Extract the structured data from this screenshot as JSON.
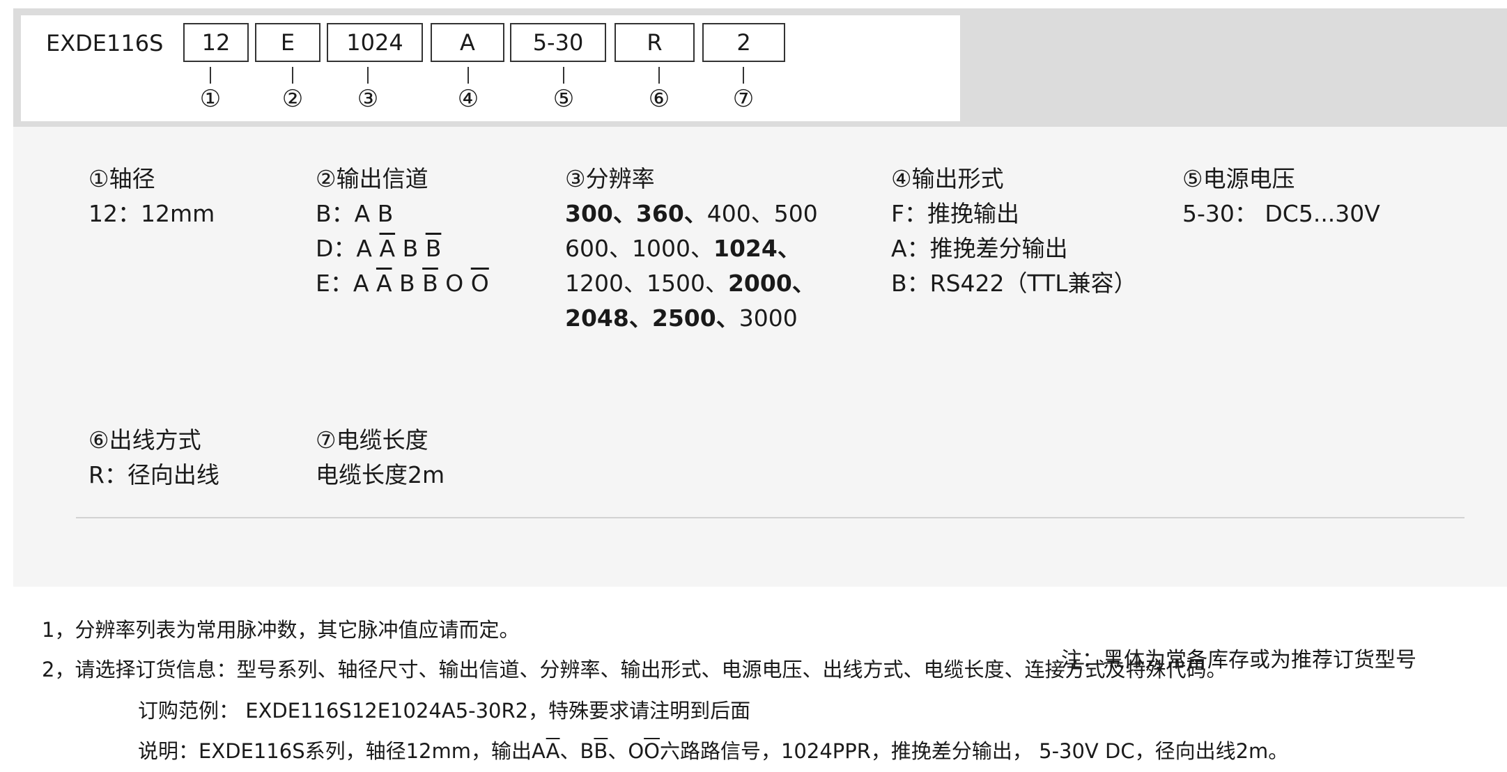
{
  "code": {
    "prefix": "EXDE116S",
    "segments": [
      {
        "value": "12",
        "num": "①"
      },
      {
        "value": "E",
        "num": "②"
      },
      {
        "value": "1024",
        "num": "③"
      },
      {
        "value": "A",
        "num": "④"
      },
      {
        "value": "5-30",
        "num": "⑤"
      },
      {
        "value": "R",
        "num": "⑥"
      },
      {
        "value": "2",
        "num": "⑦"
      }
    ]
  },
  "legend": {
    "shaft": {
      "title": "①轴径",
      "line1": "12：12mm"
    },
    "channel": {
      "title": "②输出信道",
      "b_prefix": "B：",
      "b_value": "A B",
      "d_prefix": "D：",
      "e_prefix": "E：",
      "sig_a": "A",
      "sig_b": "B",
      "sig_o": "O"
    },
    "resolution": {
      "title": "③分辨率",
      "r300": "300、",
      "r360": "360、",
      "r400_500": "400、500",
      "r600_1000": "600、1000、",
      "r1024": "1024、",
      "r1200_1500": "1200、1500、",
      "r2000": "2000、",
      "r2048": "2048、",
      "r2500": "2500、",
      "r3000": "3000"
    },
    "output": {
      "title": "④输出形式",
      "line1": "F：推挽输出",
      "line2": "A：推挽差分输出",
      "line3": "B：RS422（TTL兼容）"
    },
    "voltage": {
      "title": "⑤电源电压",
      "line1": "5-30： DC5...30V"
    },
    "wiring": {
      "title": "⑥出线方式",
      "line1": "R：径向出线"
    },
    "cable": {
      "title": "⑦电缆长度",
      "line1": "电缆长度2m"
    },
    "note": "注：黑体为常备库存或为推荐订货型号"
  },
  "footer": {
    "line1": "1，分辨率列表为常用脉冲数，其它脉冲值应请而定。",
    "line2": "2，请选择订货信息：型号系列、轴径尺寸、输出信道、分辨率、输出形式、电源电压、出线方式、电缆长度、连接方式及特殊代码。",
    "line3": "订购范例： EXDE116S12E1024A5-30R2，特殊要求请注明到后面",
    "line4_a": "说明：EXDE116S系列，轴径12mm，输出A",
    "line4_b": "、B",
    "line4_c": "、O",
    "line4_d": "六路路信号，1024PPR，推挽差分输出， 5-30V DC，径向出线2m。",
    "sig_a": "A",
    "sig_b": "B",
    "sig_o": "O"
  }
}
